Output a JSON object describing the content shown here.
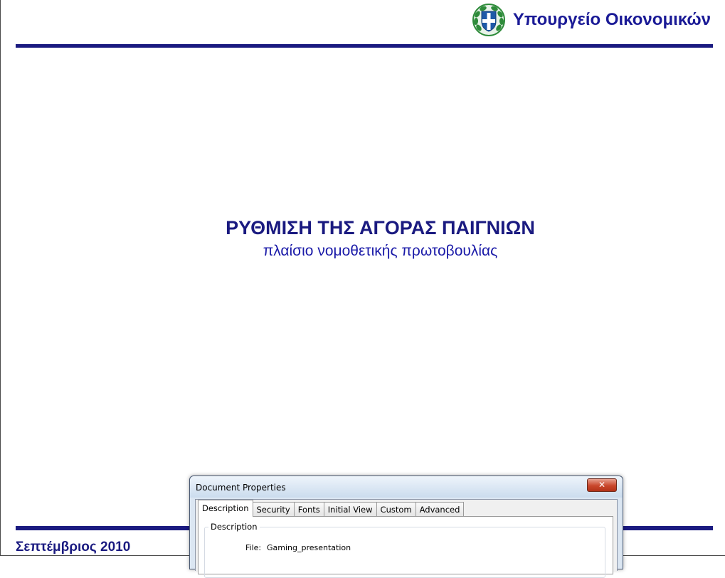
{
  "header": {
    "ministry_name": "Υπουργείο Οικονομικών",
    "emblem_icon": "greek-coat-of-arms-icon"
  },
  "slide": {
    "title": "ΡΥΘΜΙΣΗ ΤΗΣ ΑΓΟΡΑΣ ΠΑΙΓΝΙΩΝ",
    "subtitle": "πλαίσιο νομοθετικής πρωτοβουλίας"
  },
  "footer": {
    "date": "Σεπτέμβριος 2010"
  },
  "dialog": {
    "title": "Document Properties",
    "close_icon": "close-icon",
    "tabs": [
      {
        "label": "Description",
        "active": true
      },
      {
        "label": "Security",
        "active": false
      },
      {
        "label": "Fonts",
        "active": false
      },
      {
        "label": "Initial View",
        "active": false
      },
      {
        "label": "Custom",
        "active": false
      },
      {
        "label": "Advanced",
        "active": false
      }
    ],
    "group_label": "Description",
    "fields": [
      {
        "label": "File:",
        "value": "Gaming_presentation"
      }
    ]
  },
  "colors": {
    "brand_navy": "#1a1a80",
    "emblem_green": "#2e8b3a",
    "emblem_blue": "#1f5aa8"
  }
}
